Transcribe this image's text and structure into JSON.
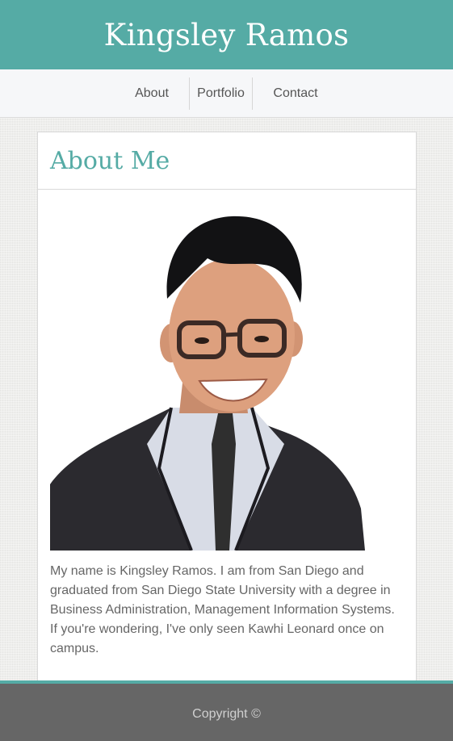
{
  "header": {
    "title": "Kingsley Ramos"
  },
  "nav": {
    "items": [
      {
        "label": "About"
      },
      {
        "label": "Portfolio"
      },
      {
        "label": "Contact"
      }
    ]
  },
  "about": {
    "heading": "About Me",
    "photo_alt": "Portrait of Kingsley Ramos",
    "bio": "My name is Kingsley Ramos. I am from San Diego and graduated from San Diego State University with a degree in Business Administration, Management Information Systems. If you're wondering, I've only seen Kawhi Leonard once on campus."
  },
  "footer": {
    "copyright": "Copyright ©"
  },
  "colors": {
    "accent": "#55aba5",
    "nav_background": "#f6f7f9",
    "footer_background": "#666666",
    "body_text": "#666666"
  }
}
